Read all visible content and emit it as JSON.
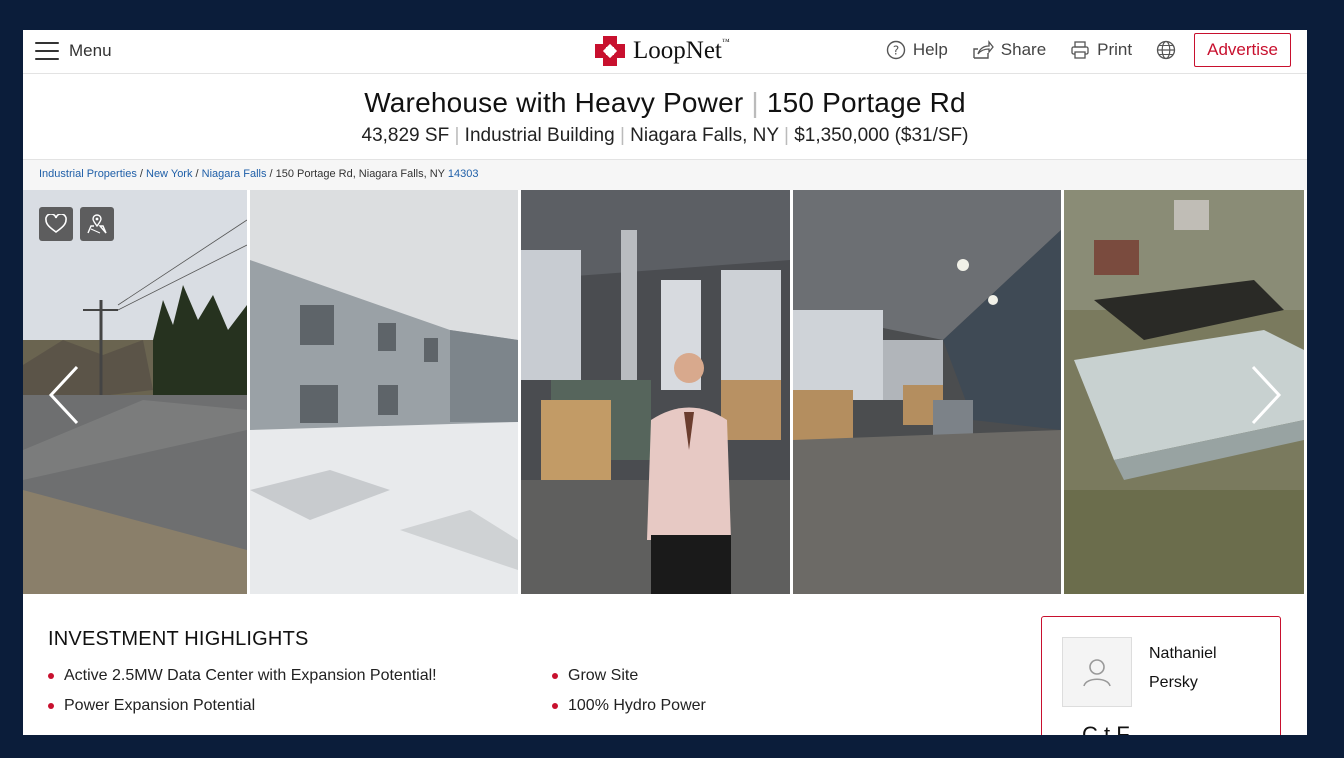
{
  "header": {
    "menu_label": "Menu",
    "logo_text": "LoopNet",
    "logo_tm": "™",
    "help_label": "Help",
    "share_label": "Share",
    "print_label": "Print",
    "advertise_label": "Advertise"
  },
  "listing": {
    "title_left": "Warehouse with Heavy Power",
    "title_sep": "|",
    "title_right": "150 Portage Rd",
    "size": "43,829 SF",
    "type": "Industrial Building",
    "location": "Niagara Falls, NY",
    "price": "$1,350,000 ($31/SF)"
  },
  "breadcrumb": {
    "items": [
      "Industrial Properties",
      "New York",
      "Niagara Falls"
    ],
    "address": "150 Portage Rd, Niagara Falls, NY",
    "zip": "14303"
  },
  "highlights": {
    "title": "INVESTMENT HIGHLIGHTS",
    "items": [
      "Active 2.5MW Data Center with Expansion Potential!",
      "Grow Site",
      "Power Expansion Potential",
      "100% Hydro Power"
    ]
  },
  "contact": {
    "first_name": "Nathaniel",
    "last_name": "Persky",
    "cta_partial": "C     t  F"
  },
  "colors": {
    "brand_red": "#c8102e",
    "link_blue": "#1f5fa8",
    "page_bg": "#0b1d3a"
  },
  "icons": [
    "menu-icon",
    "loopnet-logo-icon",
    "help-icon",
    "share-icon",
    "print-icon",
    "globe-icon",
    "heart-icon",
    "map-pin-icon",
    "chevron-left-icon",
    "chevron-right-icon",
    "user-icon"
  ]
}
